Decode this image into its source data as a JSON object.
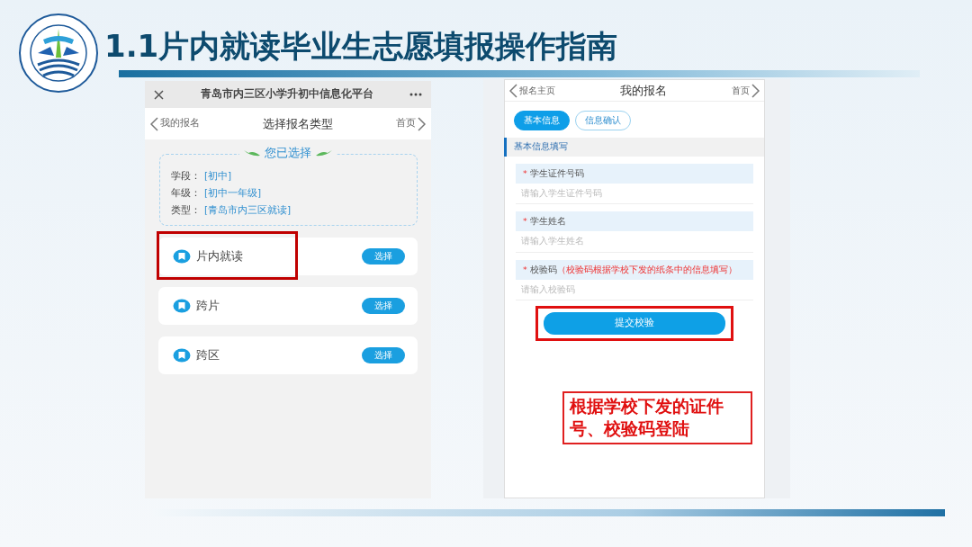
{
  "title": "1.1片内就读毕业生志愿填报操作指南",
  "left_screen": {
    "app_bar": {
      "title": "青岛市内三区小学升初中信息化平台"
    },
    "nav": {
      "back_label": "我的报名",
      "title": "选择报名类型",
      "home_label": "首页"
    },
    "summary": {
      "heading": "您已选择",
      "fields": [
        {
          "label": "学段：",
          "value": "[初中]"
        },
        {
          "label": "年级：",
          "value": "[初中一年级]"
        },
        {
          "label": "类型：",
          "value": "[青岛市内三区就读]"
        }
      ]
    },
    "options": [
      {
        "label": "片内就读",
        "button": "选择",
        "highlighted": true
      },
      {
        "label": "跨片",
        "button": "选择",
        "highlighted": false
      },
      {
        "label": "跨区",
        "button": "选择",
        "highlighted": false
      }
    ]
  },
  "right_screen": {
    "nav": {
      "back_label": "报名主页",
      "title": "我的报名",
      "home_label": "首页"
    },
    "tabs": [
      {
        "label": "基本信息",
        "selected": true
      },
      {
        "label": "信息确认",
        "selected": false
      }
    ],
    "section_title": "基本信息填写",
    "fields": [
      {
        "marker": "*",
        "label": "学生证件号码",
        "placeholder": "请输入学生证件号码"
      },
      {
        "marker": "*",
        "label": "学生姓名",
        "placeholder": "请输入学生姓名"
      },
      {
        "marker": "*",
        "label": "校验码",
        "note": "（校验码根据学校下发的纸条中的信息填写）",
        "placeholder": "请输入校验码"
      }
    ],
    "submit": {
      "label": "提交校验",
      "highlighted": true
    }
  },
  "callout": {
    "text": "根据学校下发的证件号、校验码登陆"
  }
}
